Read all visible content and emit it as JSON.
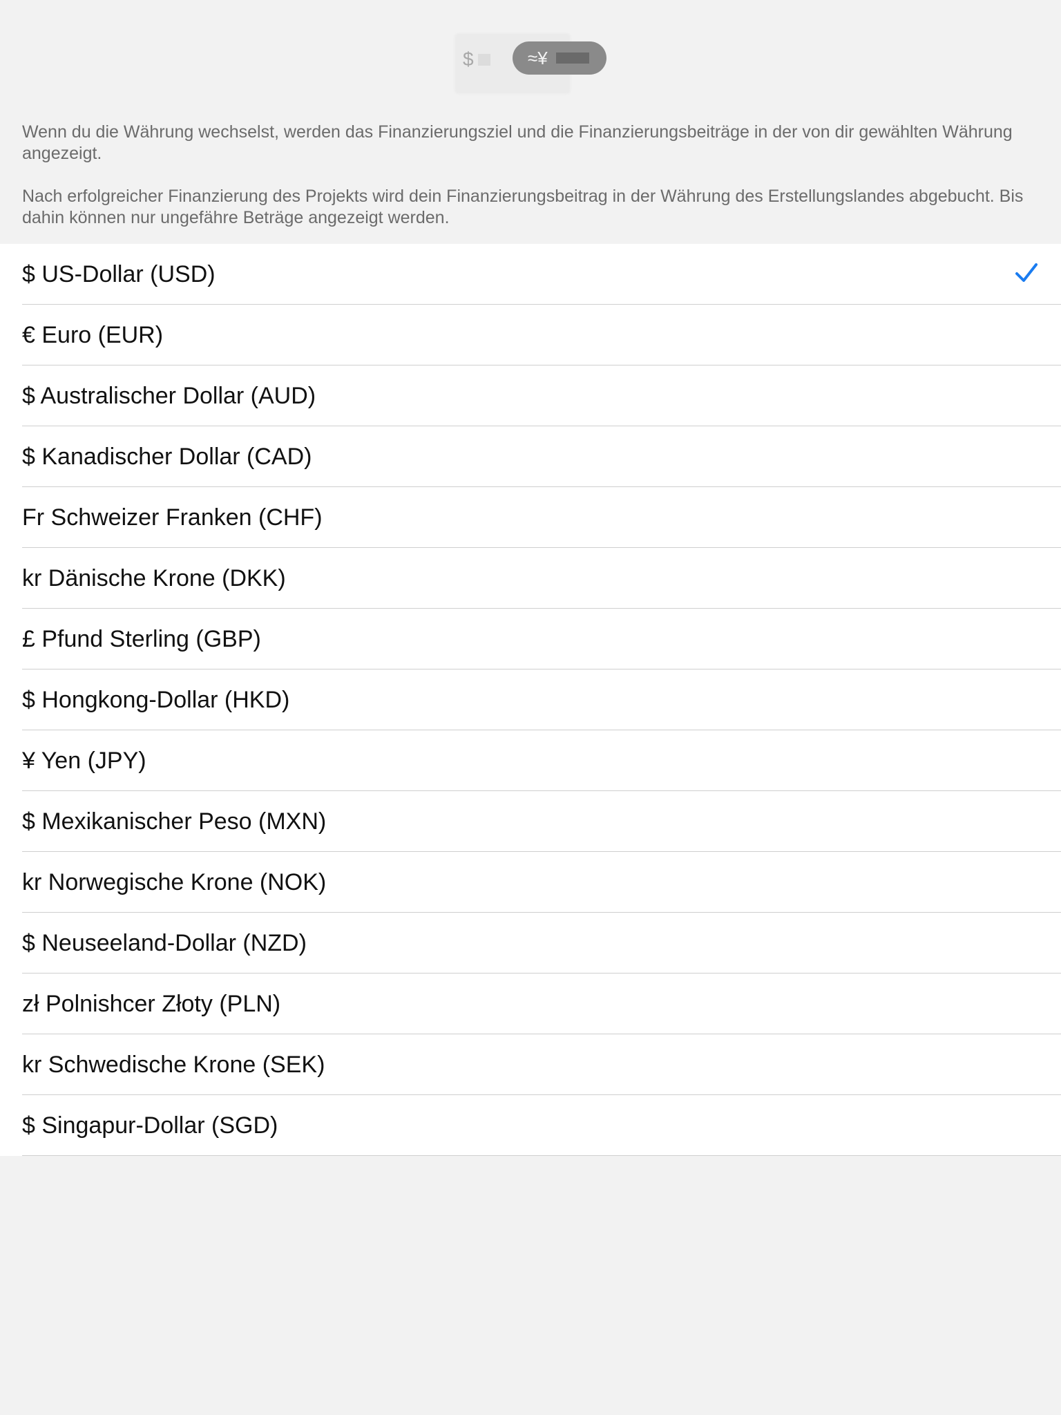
{
  "header": {
    "toggle_left_symbol": "$",
    "toggle_right_symbol": "≈¥"
  },
  "info": {
    "paragraph1": "Wenn du die Währung wechselst, werden das Finanzierungsziel und die Finanzierungsbeiträge in der von dir gewählten Währung angezeigt.",
    "paragraph2": "Nach erfolgreicher Finanzierung des Projekts wird dein Finanzierungsbeitrag in der Währung des Erstellungslandes abgebucht. Bis dahin können nur ungefähre Beträge angezeigt werden."
  },
  "currencies": [
    {
      "label": "$ US-Dollar (USD)",
      "selected": true
    },
    {
      "label": "€ Euro (EUR)"
    },
    {
      "label": "$ Australischer Dollar (AUD)"
    },
    {
      "label": "$ Kanadischer Dollar (CAD)"
    },
    {
      "label": "Fr Schweizer Franken (CHF)"
    },
    {
      "label": "kr Dänische Krone (DKK)"
    },
    {
      "label": "£ Pfund Sterling (GBP)"
    },
    {
      "label": "$ Hongkong-Dollar (HKD)"
    },
    {
      "label": "¥ Yen (JPY)"
    },
    {
      "label": "$ Mexikanischer Peso (MXN)"
    },
    {
      "label": "kr Norwegische Krone (NOK)"
    },
    {
      "label": "$ Neuseeland-Dollar (NZD)"
    },
    {
      "label": "zł Polnishcer Złoty (PLN)"
    },
    {
      "label": "kr Schwedische Krone (SEK)"
    },
    {
      "label": "$ Singapur-Dollar (SGD)"
    }
  ],
  "colors": {
    "accent": "#1a7cf0",
    "background": "#f2f2f2",
    "list_background": "#ffffff"
  },
  "icons": {
    "selected": "checkmark-icon"
  }
}
